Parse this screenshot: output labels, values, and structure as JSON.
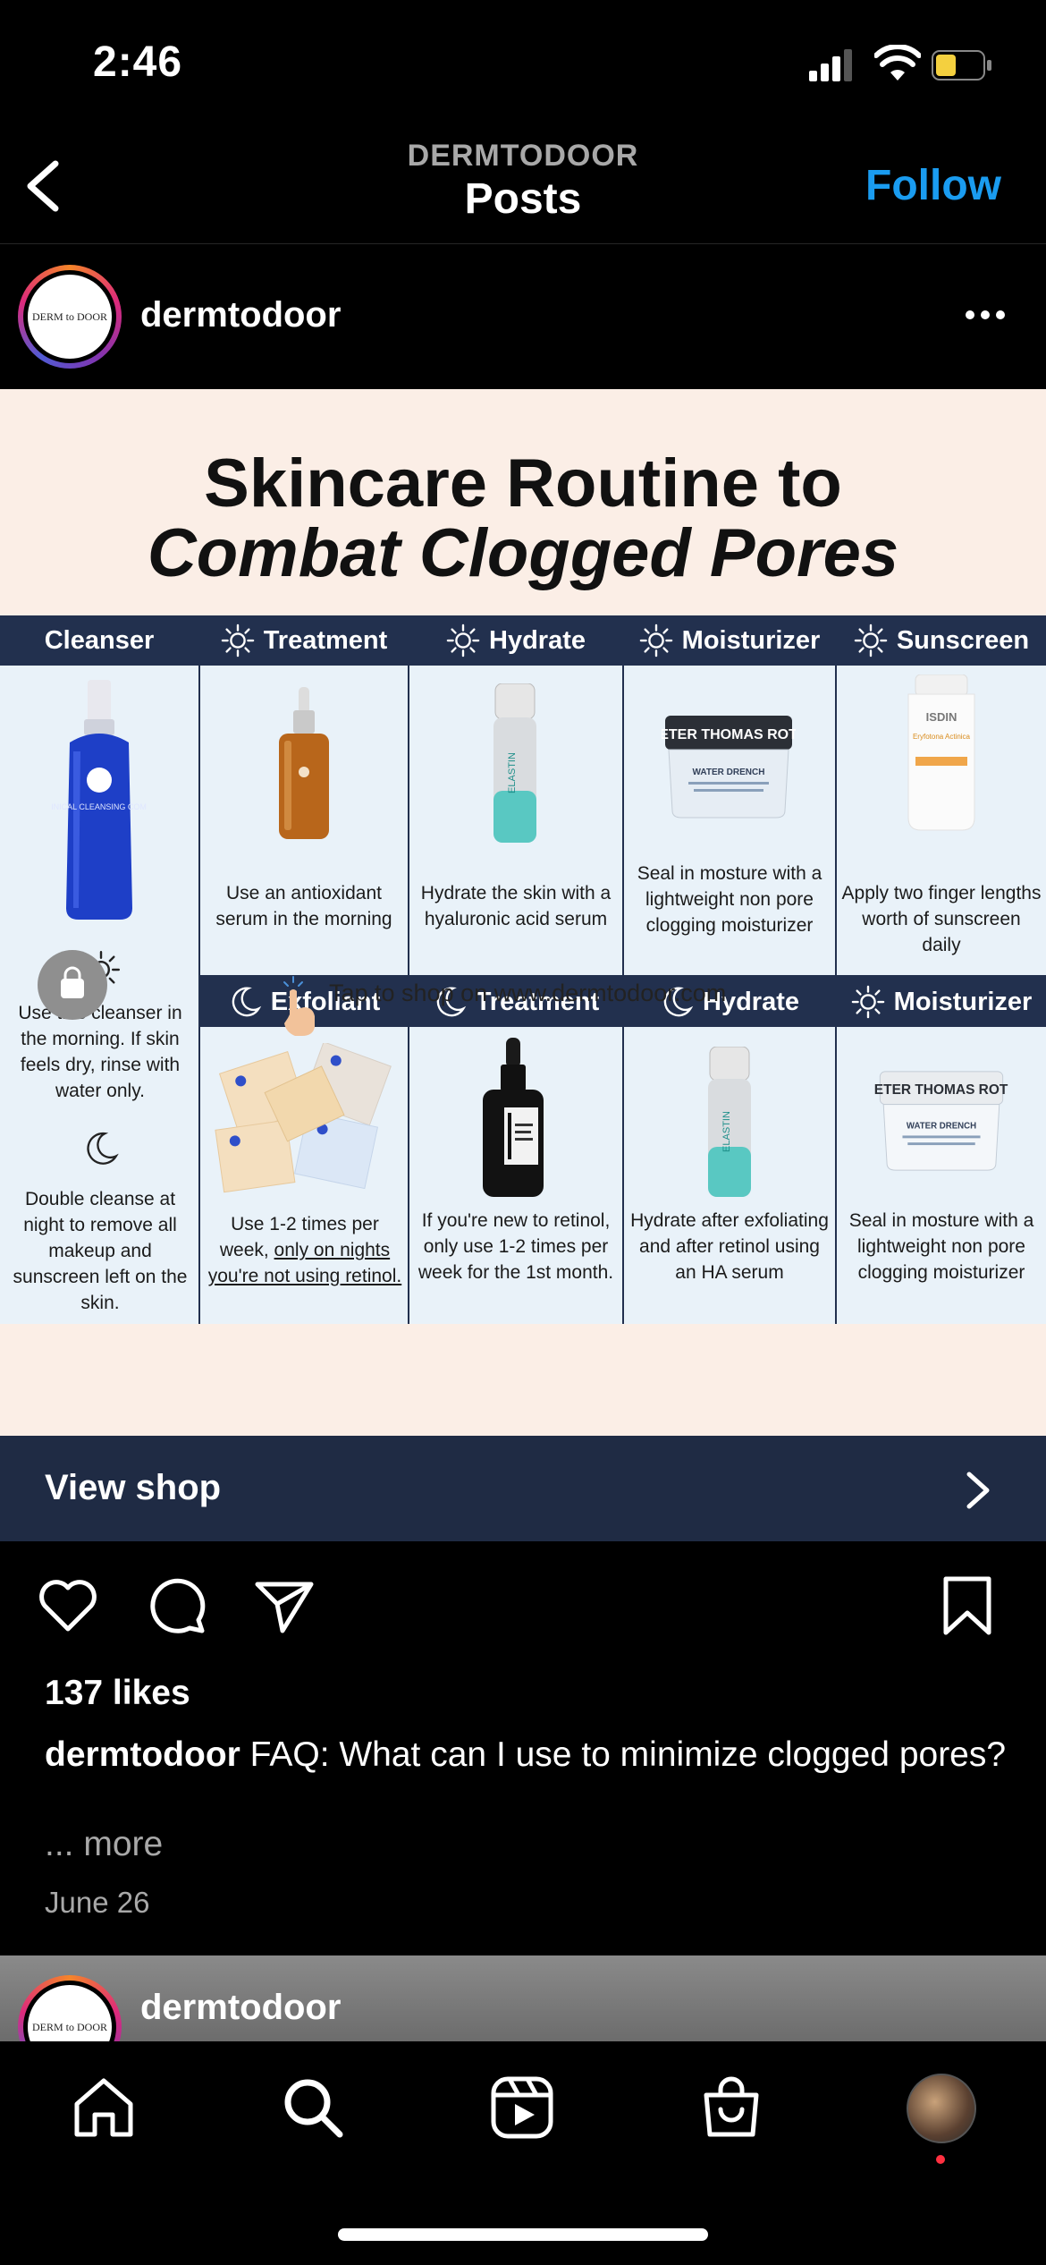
{
  "status_bar": {
    "time": "2:46"
  },
  "header": {
    "account": "DERMTODOOR",
    "title": "Posts",
    "follow_label": "Follow"
  },
  "post": {
    "username": "dermtodoor",
    "avatar_text": "DERM to DOOR",
    "image": {
      "title_line1": "Skincare Routine to",
      "title_line2": "Combat Clogged Pores",
      "top_headers": [
        "Cleanser",
        "Treatment",
        "Hydrate",
        "Moisturizer",
        "Sunscreen"
      ],
      "cleanser_am_text": "Use this cleanser in the morning. If skin feels dry, rinse with water only.",
      "cleanser_pm_text": "Double cleanse at night to remove all makeup and sunscreen left on the skin.",
      "top_texts": [
        "Use an antioxidant serum in the morning",
        "Hydrate the skin with a hyaluronic acid serum",
        "Seal in mosture with a lightweight non pore clogging moisturizer",
        "Apply two finger lengths worth of sunscreen daily"
      ],
      "bottom_headers": [
        "Exfoliant",
        "Treatment",
        "Hydrate",
        "Moisturizer"
      ],
      "bottom_texts": [
        "Use 1-2 times per week,",
        "If you're new to retinol, only use 1-2 times per week for the 1st month.",
        "Hydrate after exfoliating and after retinol using an HA serum",
        "Seal in mosture with a lightweight non pore clogging moisturizer"
      ],
      "exfoliant_underlined": "only on nights you're not using retinol.",
      "product_labels": {
        "cleanser": "iS CLINICAL CLEANSING COMPLEX",
        "elastin": "ELASTIN",
        "peter": "PETER THOMAS ROTH",
        "water_drench": "WATER DRENCH",
        "isdin": "ISDIN",
        "eryfotona": "Eryfotona Actinica"
      },
      "tap_text": "Tap to shop on www.dermtodoor.com"
    },
    "view_shop_label": "View shop",
    "likes": "137 likes",
    "caption_user": "dermtodoor",
    "caption_text": "FAQ: What can I use to minimize clogged pores?",
    "more_label": "... more",
    "date": "June 26"
  },
  "next_post": {
    "username": "dermtodoor"
  },
  "colors": {
    "accent": "#1a9cf0",
    "navy": "#22304e",
    "cream": "#fbeee6",
    "cell": "#e9f2f9"
  },
  "icons": [
    "back-chevron-icon",
    "more-dots-icon",
    "sun-icon",
    "moon-icon",
    "shopping-bag-icon",
    "tap-hand-icon",
    "chevron-right-icon",
    "heart-icon",
    "comment-icon",
    "share-icon",
    "bookmark-icon",
    "home-icon",
    "search-icon",
    "reels-icon",
    "shop-icon"
  ]
}
